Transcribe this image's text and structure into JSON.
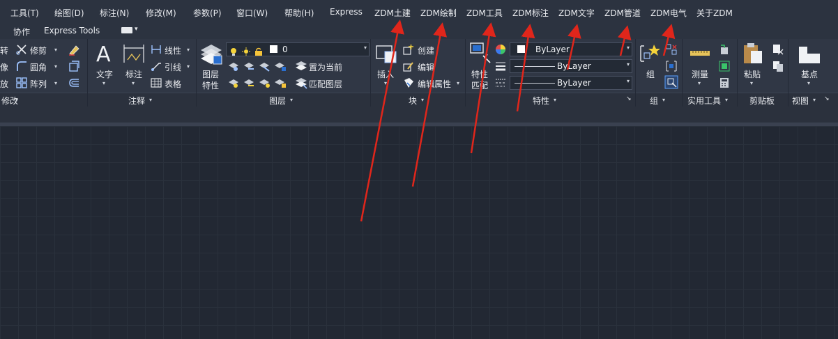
{
  "menubar": {
    "items": [
      "工具(T)",
      "绘图(D)",
      "标注(N)",
      "修改(M)",
      "参数(P)",
      "窗口(W)",
      "帮助(H)",
      "Express",
      "ZDM土建",
      "ZDM绘制",
      "ZDM工具",
      "ZDM标注",
      "ZDM文字",
      "ZDM管道",
      "ZDM电气",
      "关于ZDM"
    ]
  },
  "tabs": [
    "协作",
    "Express Tools"
  ],
  "modify": {
    "row1": "转",
    "row2": "像",
    "row3": "放",
    "trim": "修剪",
    "fillet": "圆角",
    "array": "阵列",
    "footer": "修改"
  },
  "annotation": {
    "text": "文字",
    "dimension": "标注",
    "linear": "线性",
    "leader": "引线",
    "table": "表格",
    "footer": "注释"
  },
  "layers": {
    "properties_line1": "图层",
    "properties_line2": "特性",
    "current_layer": "0",
    "set_current": "置为当前",
    "match_layer": "匹配图层",
    "footer": "图层"
  },
  "block": {
    "insert": "插入",
    "create": "创建",
    "edit": "编辑",
    "edit_attr": "编辑属性",
    "footer": "块"
  },
  "properties": {
    "match_line1": "特性",
    "match_line2": "匹配",
    "color": "ByLayer",
    "linetype": "ByLayer",
    "lineweight": "ByLayer",
    "footer": "特性",
    "corner": "↘"
  },
  "groups": {
    "group": "组",
    "footer": "组"
  },
  "utilities": {
    "measure": "测量",
    "footer": "实用工具"
  },
  "clipboard": {
    "paste": "粘贴",
    "footer": "剪贴板"
  },
  "view": {
    "base": "基点",
    "footer": "视图"
  },
  "colors": {
    "accent_arrow": "#e0261b",
    "menubar": "#2c3340",
    "ribbon": "#303745",
    "canvas": "#222833"
  }
}
